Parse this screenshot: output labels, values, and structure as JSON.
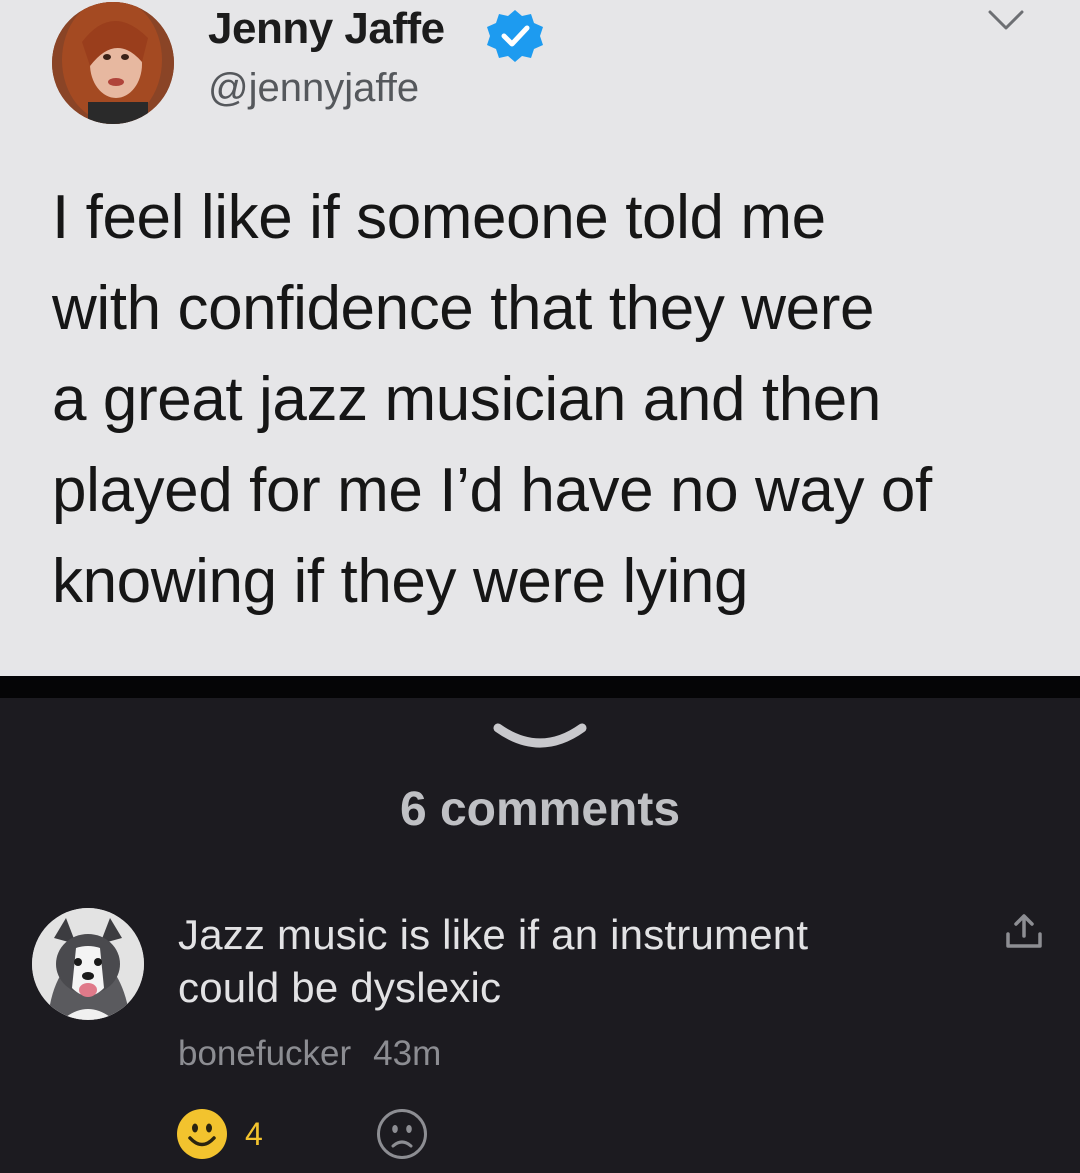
{
  "tweet": {
    "author_name": "Jenny Jaffe",
    "handle": "@jennyjaffe",
    "text_lines": [
      "I feel like if someone told me",
      "with confidence that they were",
      "a great jazz musician and then",
      "played for me I’d have no way of",
      "knowing if they were lying"
    ],
    "verified_icon": "verified-badge-icon",
    "menu_icon": "chevron-down-icon"
  },
  "thread": {
    "collapse_icon": "chevron-down-icon",
    "comments_label": "6 comments"
  },
  "comment": {
    "text_lines": [
      "Jazz music is like if an instrument",
      "could be dyslexic"
    ],
    "username": "bonefucker",
    "time": "43m",
    "upvotes": "4",
    "share_icon": "share-icon",
    "upvote_icon": "smile-icon",
    "downvote_icon": "frown-icon"
  },
  "colors": {
    "tweet_bg": "#e6e6e8",
    "dark_bg": "#1c1b20",
    "verified_blue": "#1d9bf0",
    "upvote_yellow": "#f2c32e"
  }
}
